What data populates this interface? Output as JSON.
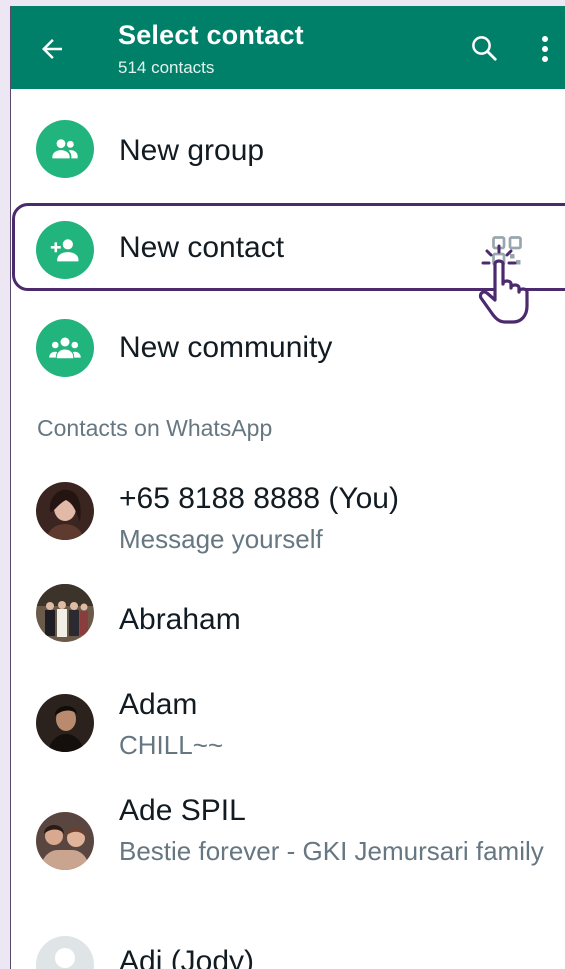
{
  "header": {
    "title": "Select contact",
    "subtitle": "514 contacts",
    "back_icon": "arrow-left-icon",
    "search_icon": "search-icon",
    "more_icon": "more-vert-icon",
    "color": "#008069"
  },
  "actions": [
    {
      "label": "New group",
      "icon": "group-icon"
    },
    {
      "label": "New contact",
      "icon": "person-add-icon",
      "trailing_icon": "qr-code-icon"
    },
    {
      "label": "New community",
      "icon": "community-icon"
    }
  ],
  "section": {
    "title": "Contacts on WhatsApp"
  },
  "contacts": [
    {
      "name": "+65 8188 8888 (You)",
      "status": "Message yourself"
    },
    {
      "name": "Abraham",
      "status": ""
    },
    {
      "name": "Adam",
      "status": "CHILL~~"
    },
    {
      "name": "Ade SPIL",
      "status": "Bestie forever - GKI Jemursari family"
    },
    {
      "name": "Adi (Jody)",
      "status": ""
    }
  ],
  "accent_color": "#21b47c",
  "highlight_color": "#4b2a6e"
}
